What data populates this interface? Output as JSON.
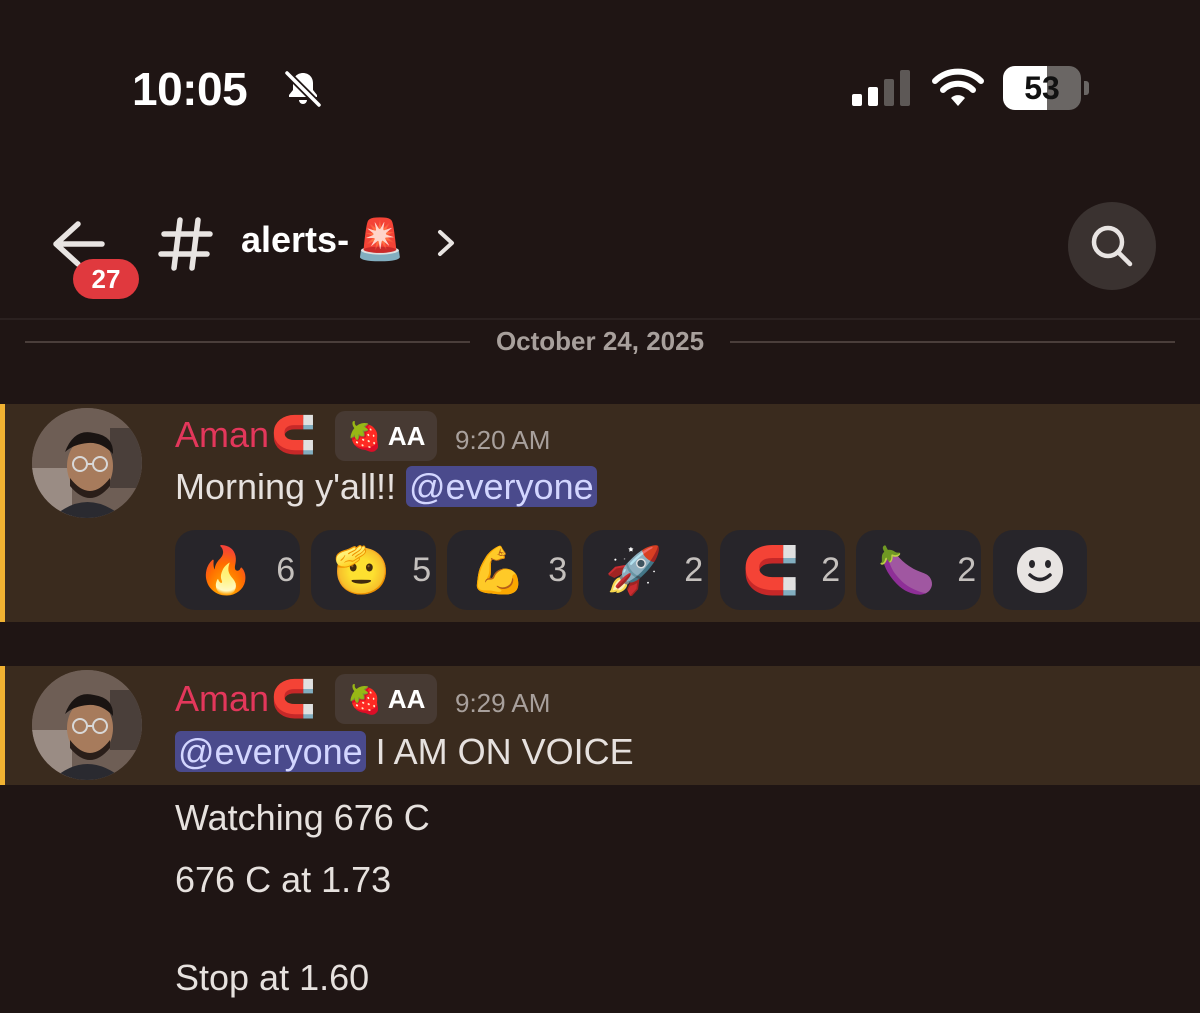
{
  "status_bar": {
    "time": "10:05",
    "battery": "53"
  },
  "header": {
    "badge_count": "27",
    "channel_name": "alerts-",
    "channel_emoji": "🚨"
  },
  "divider": {
    "date": "October 24, 2025"
  },
  "messages": [
    {
      "username": "Aman",
      "username_emoji": "🧲",
      "tag_icon": "🍓",
      "tag": "AA",
      "timestamp": "9:20 AM",
      "text_before": "Morning y'all!! ",
      "mention": "@everyone",
      "text_after": "",
      "reactions": [
        {
          "emoji": "🔥",
          "count": "6"
        },
        {
          "emoji": "🫡",
          "count": "5"
        },
        {
          "emoji": "💪",
          "count": "3"
        },
        {
          "emoji": "🚀",
          "count": "2"
        },
        {
          "emoji": "🧲",
          "count": "2"
        },
        {
          "emoji": "🍆",
          "count": "2"
        }
      ]
    },
    {
      "username": "Aman",
      "username_emoji": "🧲",
      "tag_icon": "🍓",
      "tag": "AA",
      "timestamp": "9:29 AM",
      "mention": "@everyone",
      "text_after": " I AM ON VOICE",
      "extra_lines": [
        "Watching 676 C",
        "676 C at 1.73",
        "Stop at 1.60"
      ]
    }
  ]
}
